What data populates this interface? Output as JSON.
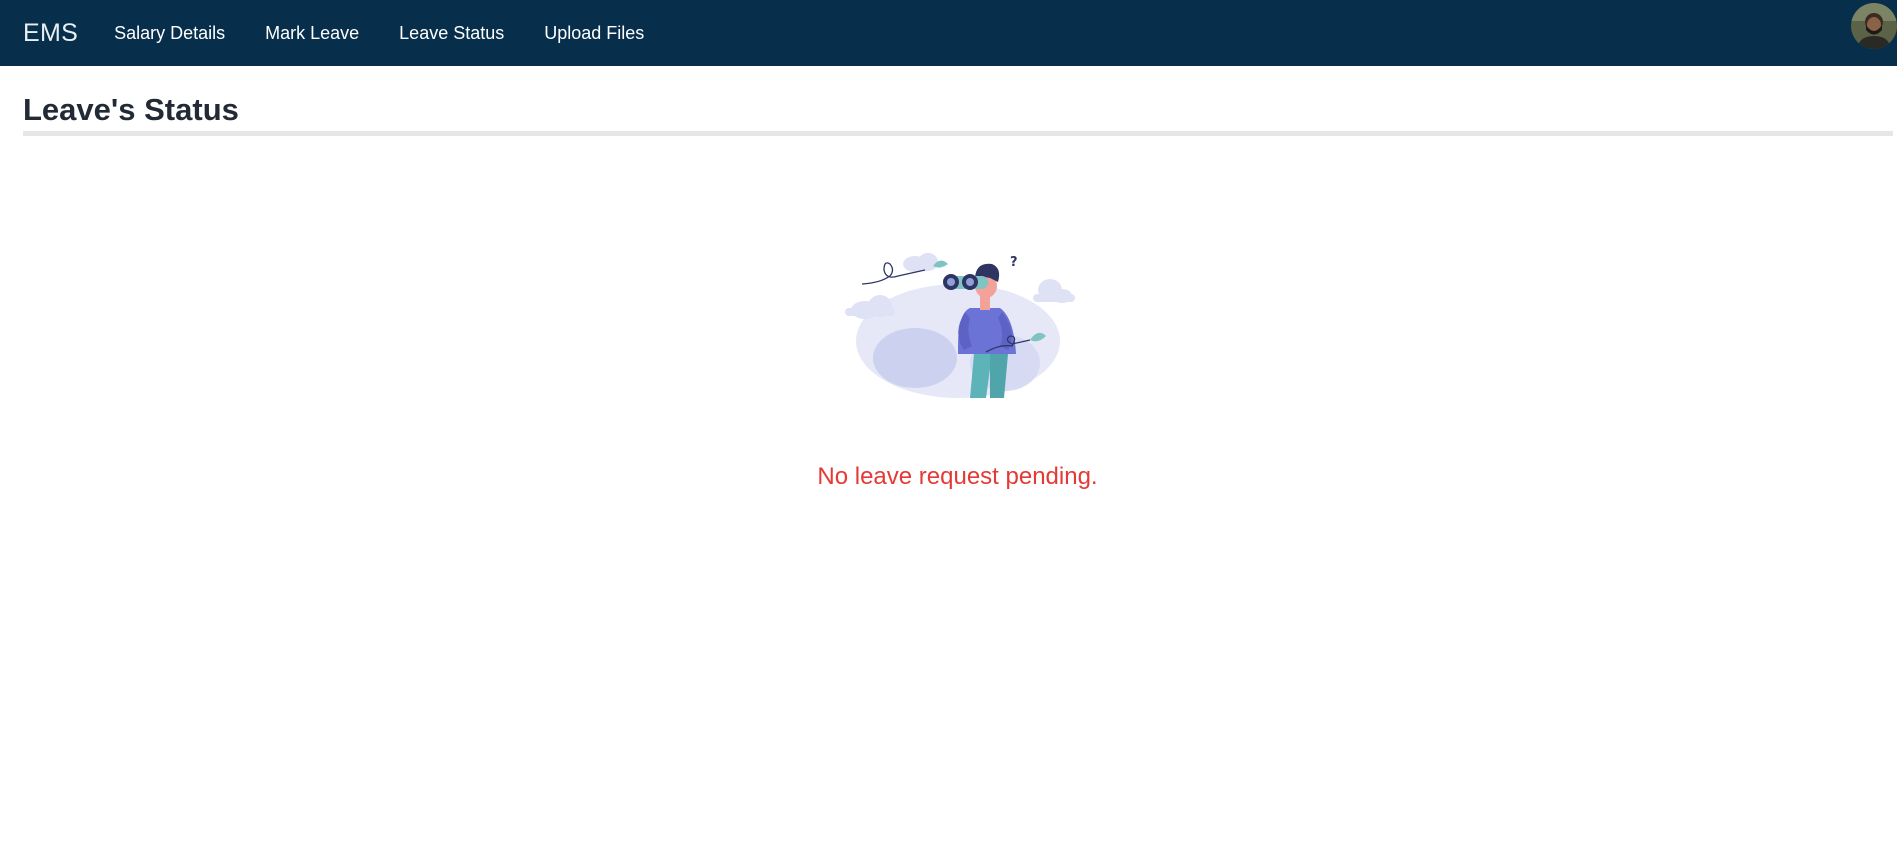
{
  "navbar": {
    "brand": "EMS",
    "links": [
      {
        "label": "Salary Details"
      },
      {
        "label": "Mark Leave"
      },
      {
        "label": "Leave Status"
      },
      {
        "label": "Upload Files"
      }
    ]
  },
  "page": {
    "title": "Leave's Status",
    "empty_message": "No leave request pending."
  },
  "colors": {
    "navbar_bg": "#072f4b",
    "message": "#e53935",
    "illustration_accent": "#6c73d6"
  }
}
